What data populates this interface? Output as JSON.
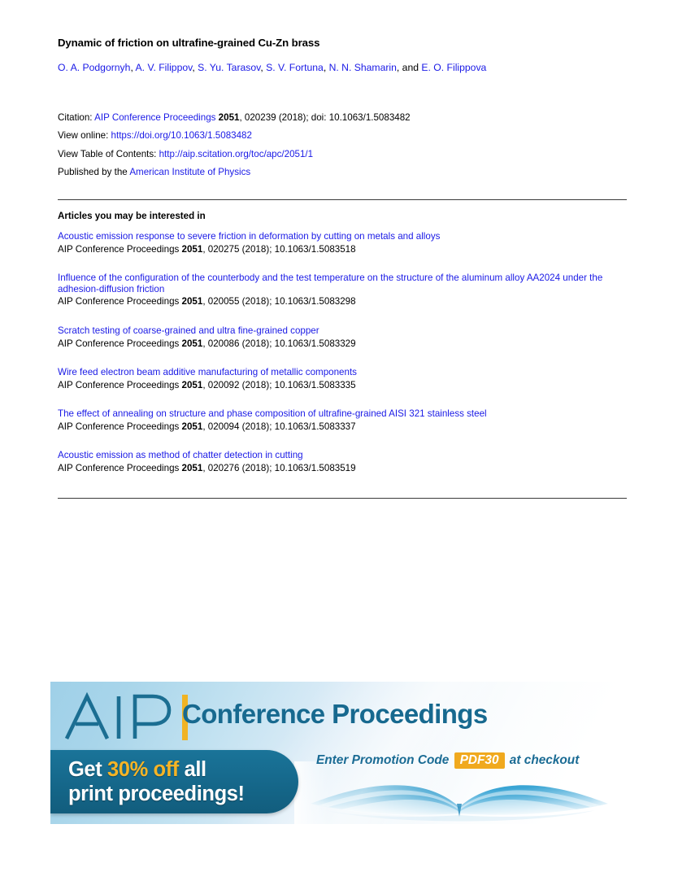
{
  "document": {
    "title": "Dynamic of friction on ultrafine-grained Cu-Zn brass",
    "authors": {
      "names": [
        "O. A. Podgornyh",
        "A. V. Filippov",
        "S. Yu. Tarasov",
        "S. V. Fortuna",
        "N. N. Shamarin",
        "E. O. Filippova"
      ],
      "separator": ", ",
      "conjunction": ", and "
    }
  },
  "citation": {
    "citation_label": "Citation: ",
    "journal": "AIP Conference Proceedings",
    "volume": "2051",
    "article_number": ", 020239 (2018); doi: 10.1063/1.5083482",
    "view_online_label": "View online: ",
    "view_online_url": "https://doi.org/10.1063/1.5083482",
    "toc_label": "View Table of Contents: ",
    "toc_url": "http://aip.scitation.org/toc/apc/2051/1",
    "publisher_label": "Published by the ",
    "publisher": "American Institute of Physics"
  },
  "related": {
    "heading": "Articles you may be interested in",
    "articles": [
      {
        "title": "Acoustic emission response to severe friction in deformation by cutting on metals and alloys",
        "journal": "AIP Conference Proceedings ",
        "volume": "2051",
        "details": ", 020275 (2018); 10.1063/1.5083518"
      },
      {
        "title": "Influence of the configuration of the counterbody and the test temperature on the structure of the aluminum alloy AA2024 under the adhesion-diffusion friction",
        "journal": "AIP Conference Proceedings ",
        "volume": "2051",
        "details": ", 020055 (2018); 10.1063/1.5083298"
      },
      {
        "title": "Scratch testing of coarse-grained and ultra fine-grained copper",
        "journal": "AIP Conference Proceedings ",
        "volume": "2051",
        "details": ", 020086 (2018); 10.1063/1.5083329"
      },
      {
        "title": "Wire feed electron beam additive manufacturing of metallic components",
        "journal": "AIP Conference Proceedings ",
        "volume": "2051",
        "details": ", 020092 (2018); 10.1063/1.5083335"
      },
      {
        "title": "The effect of annealing on structure and phase composition of ultrafine-grained AISI 321 stainless steel",
        "journal": "AIP Conference Proceedings ",
        "volume": "2051",
        "details": ", 020094 (2018); 10.1063/1.5083337"
      },
      {
        "title": "Acoustic emission as method of chatter detection in cutting",
        "journal": "AIP Conference Proceedings ",
        "volume": "2051",
        "details": ", 020276 (2018); 10.1063/1.5083519"
      }
    ]
  },
  "advertisement": {
    "logo_text": "AIP",
    "brand_line": "Conference Proceedings",
    "offer_line_1_prefix": "Get ",
    "offer_line_1_highlight": "30% off",
    "offer_line_1_suffix": " all",
    "offer_line_2": "print proceedings!",
    "promo_prefix": "Enter Promotion Code",
    "promo_code": "PDF30",
    "promo_suffix": "at checkout",
    "colors": {
      "teal_pill": "#15678a",
      "gold": "#f5b426",
      "promo_code_bg": "#f0a91e",
      "brand_teal": "#17698f"
    }
  },
  "colors": {
    "link": "#1a1ae6",
    "text": "#000000",
    "rule": "#3a3a3a"
  }
}
